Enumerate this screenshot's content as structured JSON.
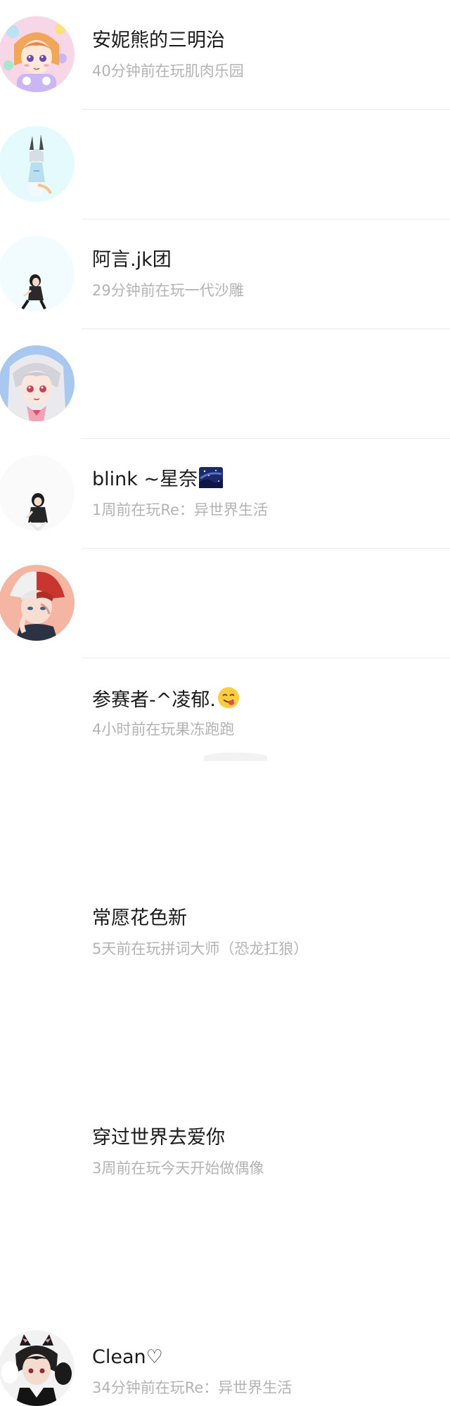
{
  "friends": [
    {
      "name": "安妮熊的三明治",
      "status": "40分钟前在玩肌肉乐园",
      "avatar_icon": "anime-girl-pastel-avatar-icon"
    },
    {
      "name": "阿言.jk团",
      "status": "29分钟前在玩一代沙雕",
      "avatar_icon": "bunny-ear-figure-avatar-icon"
    },
    {
      "name": "blink ~星奈",
      "status": "1周前在玩Re：异世界生活",
      "avatar_icon": "dark-hair-figure-avatar-icon",
      "emoji": "night-sky-emoji-icon"
    },
    {
      "name": "参赛者-^凌郁.",
      "status": "4小时前在玩果冻跑跑",
      "avatar_icon": "silver-hair-anime-avatar-icon",
      "emoji": "yum-face-emoji-icon"
    },
    {
      "name": "常愿花色新",
      "status": "5天前在玩拼词大师（恐龙扛狼）",
      "avatar_icon": "black-hair-figure-avatar-icon"
    },
    {
      "name": "穿过世界去爱你",
      "status": "3周前在玩今天开始做偶像",
      "avatar_icon": "red-white-hair-anime-avatar-icon"
    },
    {
      "name": "Clean♡",
      "status": "34分钟前在玩Re：异世界生活",
      "avatar_icon": "cat-ear-anime-avatar-icon"
    }
  ],
  "colors": {
    "name_text": "#1a1a1a",
    "status_text": "#b3b3b3",
    "divider": "#ebebeb",
    "background": "#ffffff"
  }
}
